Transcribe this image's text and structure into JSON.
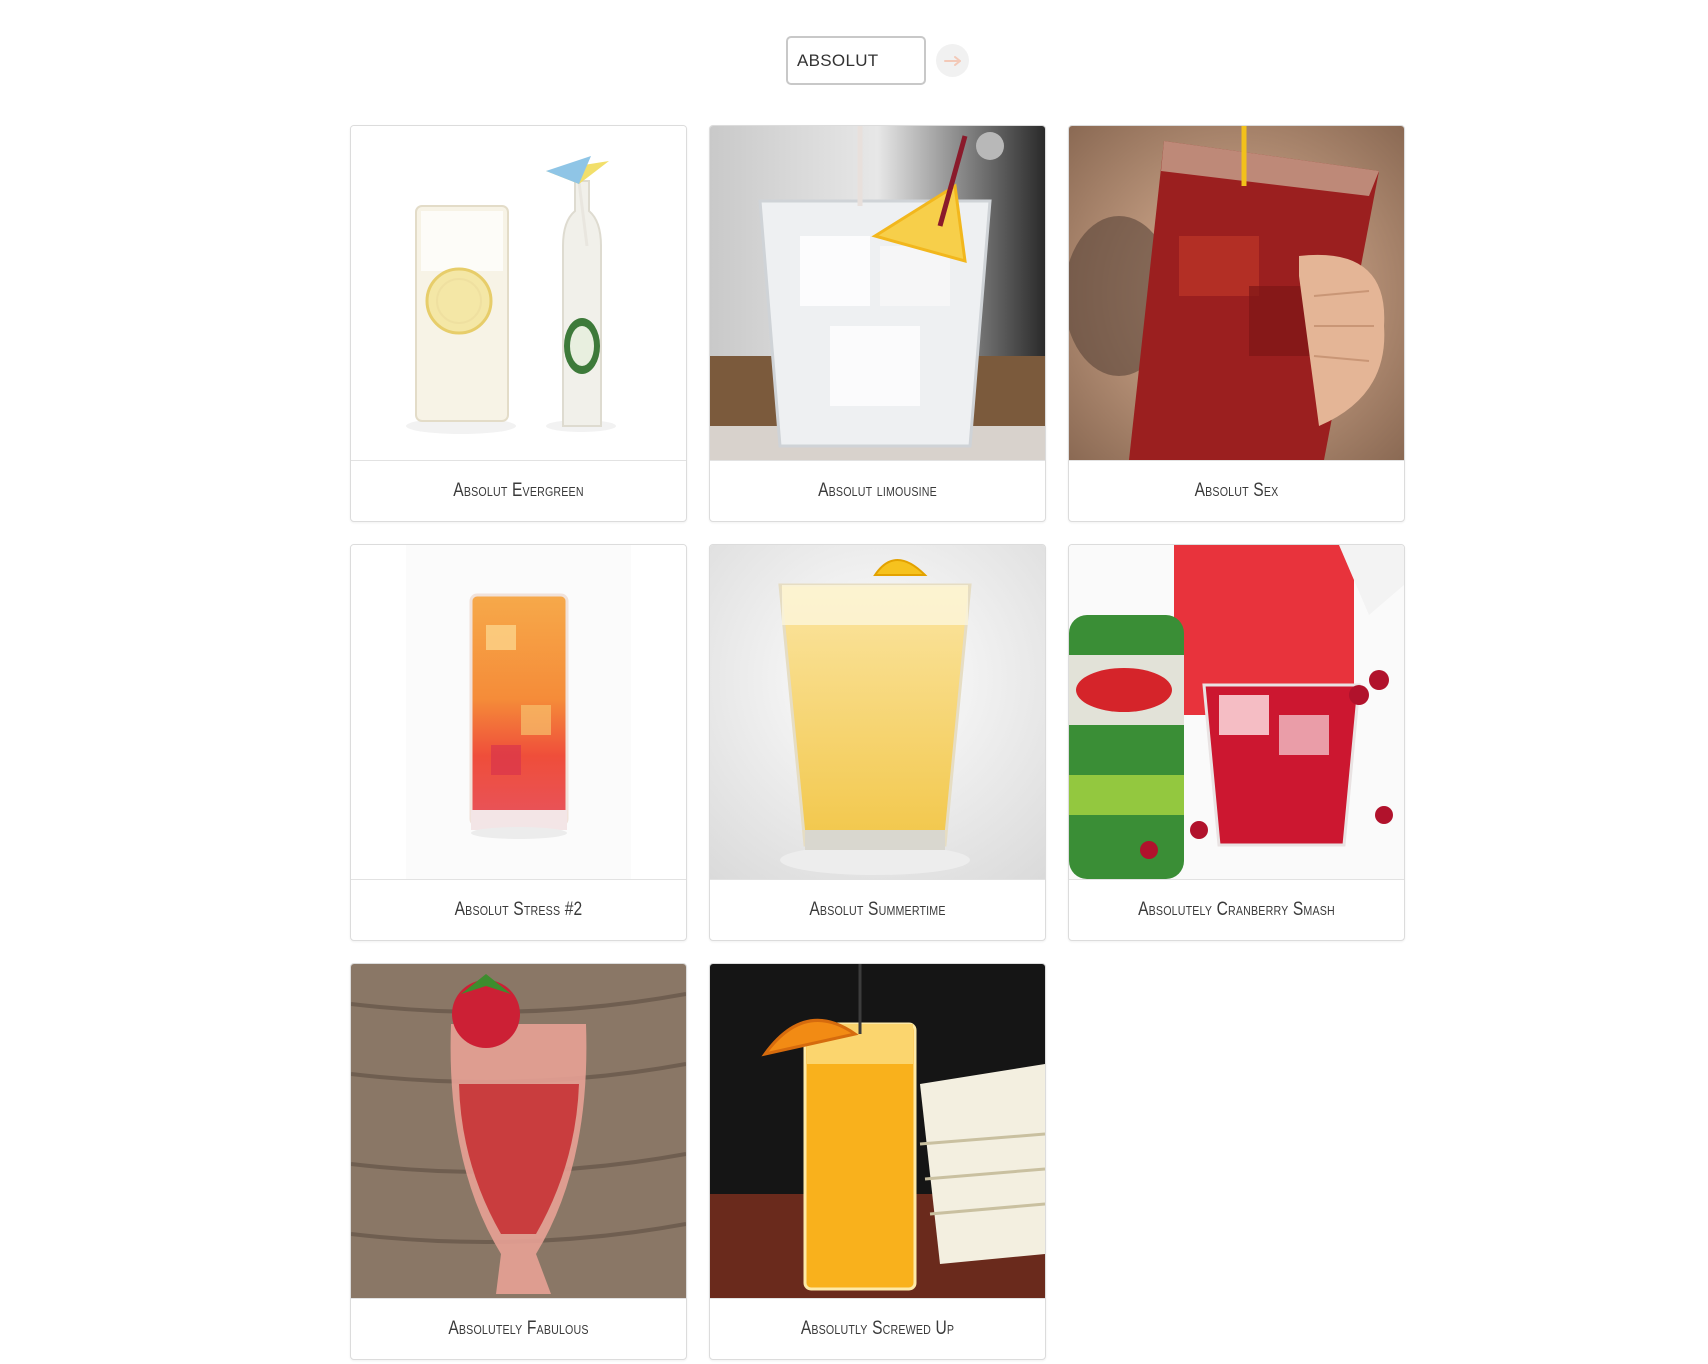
{
  "search": {
    "value": "ABSOLUT",
    "placeholder": "",
    "button_icon": "arrow-right-icon",
    "button_icon_color": "#f3c9b8"
  },
  "cocktails": [
    {
      "name": "Absolut Evergreen",
      "image_icon": "tall-glass-lemonade-with-bottle-photo"
    },
    {
      "name": "Absolut limousine",
      "image_icon": "ice-glass-with-lemon-photo"
    },
    {
      "name": "Absolut Sex",
      "image_icon": "red-drink-in-hand-photo"
    },
    {
      "name": "Absolut Stress #2",
      "image_icon": "orange-red-highball-photo"
    },
    {
      "name": "Absolut Summertime",
      "image_icon": "yellow-drink-with-lemon-photo"
    },
    {
      "name": "Absolutely Cranberry Smash",
      "image_icon": "cranberry-drink-with-ginger-ale-photo"
    },
    {
      "name": "Absolutely Fabulous",
      "image_icon": "champagne-flute-with-strawberry-photo"
    },
    {
      "name": "Absolutly Screwed Up",
      "image_icon": "orange-highball-with-orange-slice-photo"
    }
  ]
}
